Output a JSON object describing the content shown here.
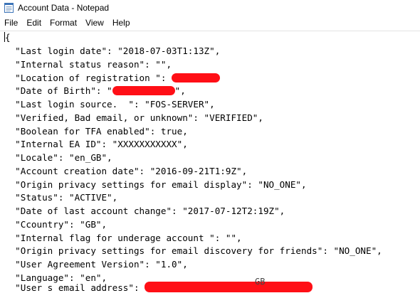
{
  "window": {
    "title": "Account Data - Notepad"
  },
  "menu": {
    "items": [
      "File",
      "Edit",
      "Format",
      "View",
      "Help"
    ]
  },
  "editor": {
    "open_brace": "{",
    "lines": [
      "  \"Last login date\": \"2018-07-03T1:13Z\",",
      "  \"Internal status reason\": \"\",",
      "  \"Location of registration \": ",
      "  \"Date of Birth\": \"",
      "  \"Last login source.  \": \"FOS-SERVER\",",
      "  \"Verified, Bad email, or unknown\": \"VERIFIED\",",
      "  \"Boolean for TFA enabled\": true,",
      "  \"Internal EA ID\": \"XXXXXXXXXXX\",",
      "  \"Locale\": \"en_GB\",",
      "  \"Account creation date\": \"2016-09-21T1:9Z\",",
      "  \"Origin privacy settings for email display\": \"NO_ONE\",",
      "  \"Status\": \"ACTIVE\",",
      "  \"Date of last account change\": \"2017-07-12T2:19Z\",",
      "  \"Ccountry\": \"GB\",",
      "  \"Internal flag for underage account \": \"\",",
      "  \"Origin privacy settings for email discovery for friends\": \"NO_ONE\",",
      "  \"User Agreement Version\": \"1.0\",",
      "  \"Language\": \"en\",",
      "  \"User s email address\": "
    ],
    "dob_suffix": "\",",
    "email_tail_fragment": "GB"
  },
  "colors": {
    "redaction": "#ff0f16",
    "text": "#000000",
    "background": "#ffffff"
  },
  "icons": {
    "app": "notepad-icon"
  }
}
